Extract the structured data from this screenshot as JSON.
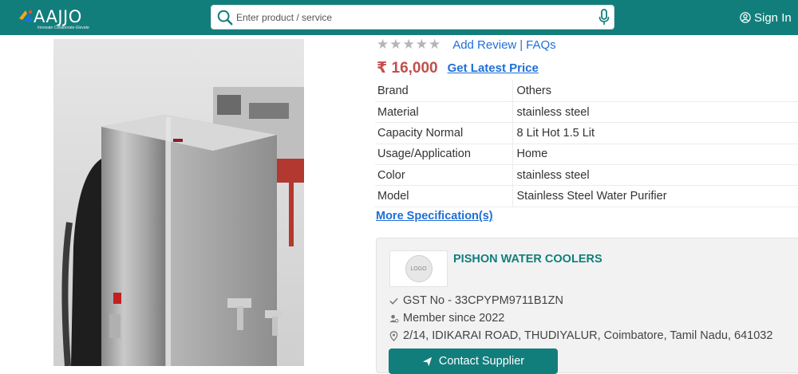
{
  "header": {
    "logo_text": "AAJJO",
    "logo_tagline": "Innovate·Collaborate·Elevate",
    "search_placeholder": "Enter product / service",
    "signin_label": "Sign In"
  },
  "product": {
    "rating_stars": "★★★★★",
    "add_review_label": "Add Review",
    "faqs_label": "FAQs",
    "price": "₹ 16,000",
    "get_price_label": "Get Latest Price",
    "specs": [
      {
        "key": "Brand",
        "value": "Others"
      },
      {
        "key": "Material",
        "value": "stainless steel"
      },
      {
        "key": "Capacity Normal",
        "value": "8 Lit Hot 1.5 Lit"
      },
      {
        "key": "Usage/Application",
        "value": "Home"
      },
      {
        "key": "Color",
        "value": "stainless steel"
      },
      {
        "key": "Model",
        "value": "Stainless Steel Water Purifier"
      }
    ],
    "more_spec_label": "More Specification(s)"
  },
  "supplier": {
    "logo_text": "LOGO",
    "name": "PISHON WATER COOLERS",
    "gst": "GST No - 33CPYPM9711B1ZN",
    "member_since": "Member since 2022",
    "address": "2/14, IDIKARAI ROAD, THUDIYALUR, Coimbatore, Tamil Nadu, 641032",
    "contact_label": "Contact Supplier"
  },
  "colors": {
    "brand_teal": "#127e7c",
    "link_blue": "#1e6fd9",
    "price_red": "#c0504d"
  }
}
